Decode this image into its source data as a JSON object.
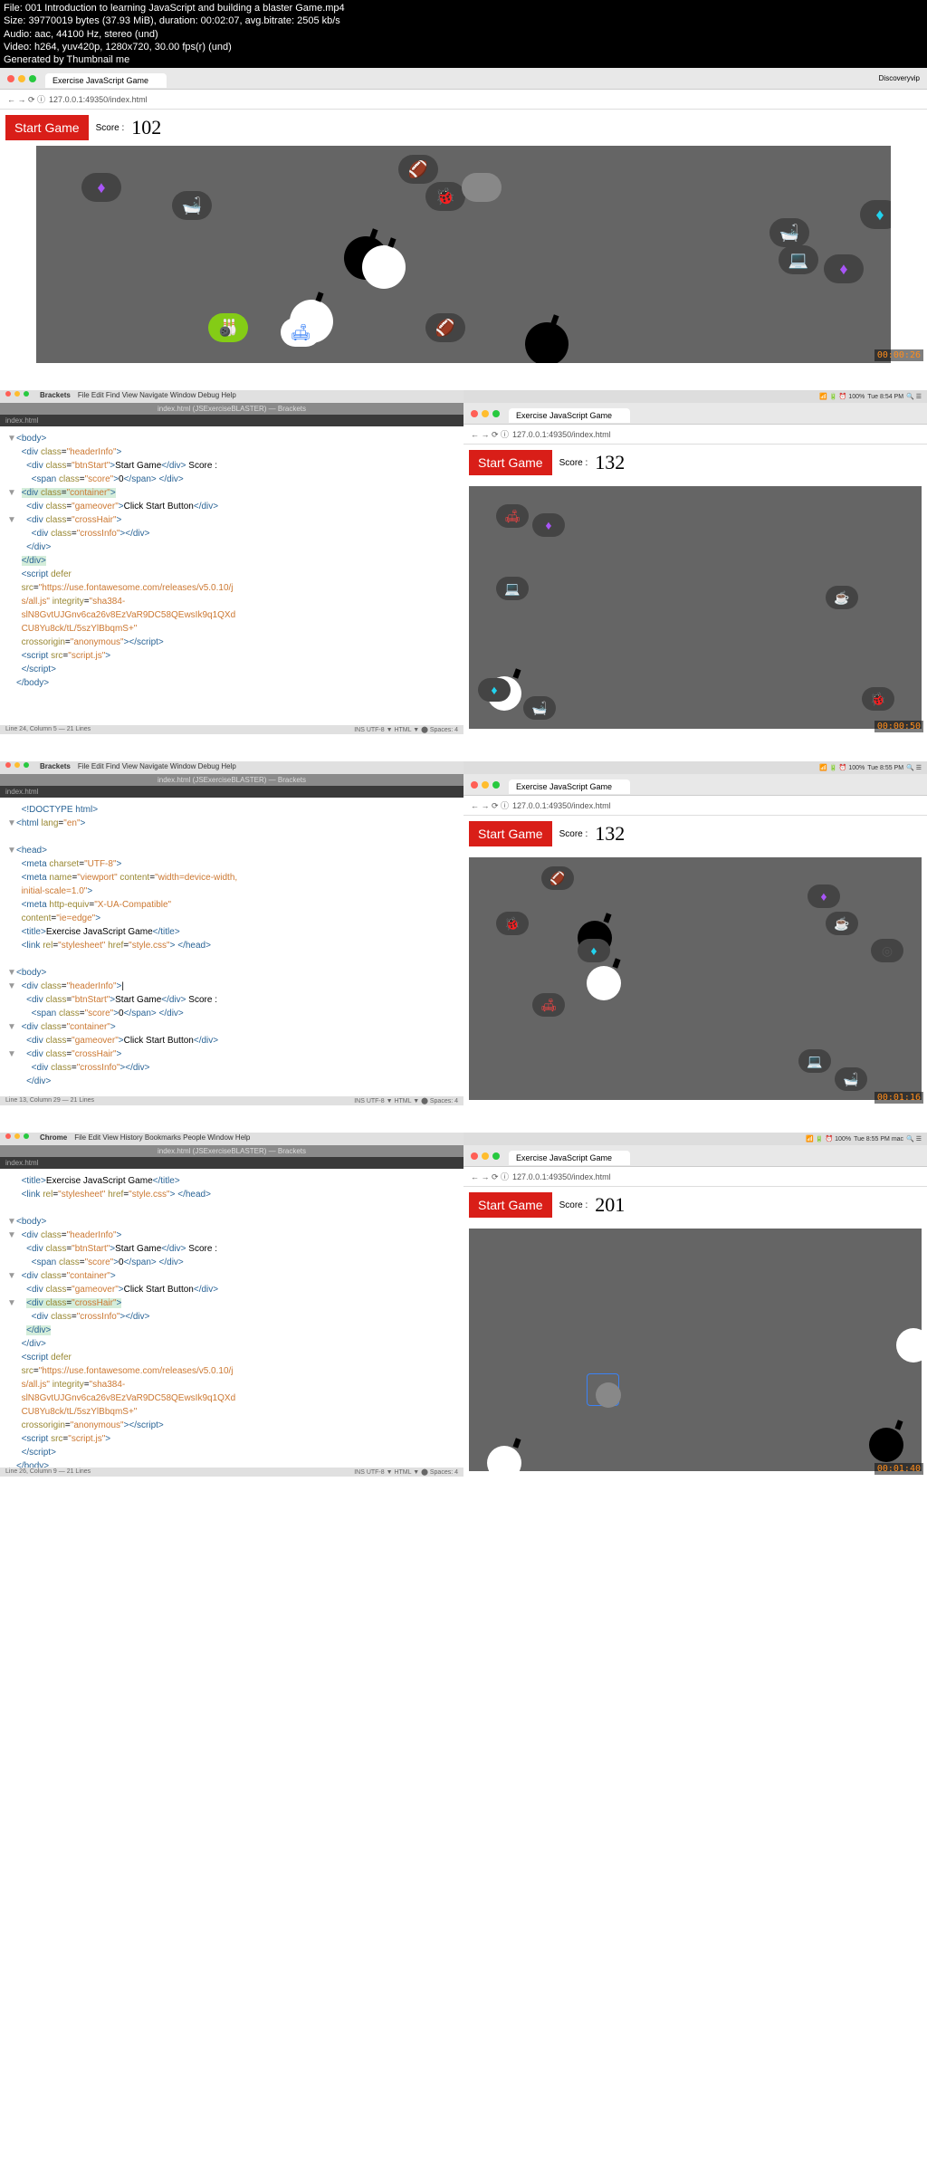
{
  "meta": {
    "l1": "File: 001 Introduction to learning JavaScript and building a blaster Game.mp4",
    "l2": "Size: 39770019 bytes (37.93 MiB), duration: 00:02:07, avg.bitrate: 2505 kb/s",
    "l3": "Audio: aac, 44100 Hz, stereo (und)",
    "l4": "Video: h264, yuv420p, 1280x720, 30.00 fps(r) (und)",
    "l5": "Generated by Thumbnail me"
  },
  "frame1": {
    "tab": "Exercise JavaScript Game",
    "url": "127.0.0.1:49350/index.html",
    "right_label": "Discoveryvip",
    "start": "Start Game",
    "score_lbl": "Score :",
    "score": "102",
    "ts": "00:00:26"
  },
  "frame2": {
    "app": "Brackets",
    "menu": "File  Edit  Find  View  Navigate  Window  Debug  Help",
    "title": "index.html (JSExerciseBLASTER) — Brackets",
    "tabfile": "index.html",
    "time": "Tue 8:54 PM",
    "tab": "Exercise JavaScript Game",
    "url": "127.0.0.1:49350/index.html",
    "start": "Start Game",
    "score_lbl": "Score :",
    "score": "132",
    "ts": "00:00:50",
    "status": "Line 24, Column 5 — 21 Lines",
    "code": [
      {
        "fold": "▼",
        "html": "<span class='t'>&lt;body&gt;</span>"
      },
      {
        "html": "&nbsp;&nbsp;<span class='t'>&lt;div</span> <span class='a'>class</span>=<span class='s'>\"headerInfo\"</span><span class='t'>&gt;</span>"
      },
      {
        "html": "&nbsp;&nbsp;&nbsp;&nbsp;<span class='t'>&lt;div</span> <span class='a'>class</span>=<span class='s'>\"btnStart\"</span><span class='t'>&gt;</span>Start Game<span class='t'>&lt;/div&gt;</span> Score :"
      },
      {
        "html": "&nbsp;&nbsp;&nbsp;&nbsp;&nbsp;&nbsp;<span class='t'>&lt;span</span> <span class='a'>class</span>=<span class='s'>\"score\"</span><span class='t'>&gt;</span>0<span class='t'>&lt;/span&gt; &lt;/div&gt;</span>"
      },
      {
        "fold": "▼",
        "html": "&nbsp;&nbsp;<span class='hl'><span class='t'>&lt;div</span> <span class='a'>class</span>=<span class='s'>\"container\"</span><span class='t'>&gt;</span></span>"
      },
      {
        "html": "&nbsp;&nbsp;&nbsp;&nbsp;<span class='t'>&lt;div</span> <span class='a'>class</span>=<span class='s'>\"gameover\"</span><span class='t'>&gt;</span>Click Start Button<span class='t'>&lt;/div&gt;</span>"
      },
      {
        "fold": "▼",
        "html": "&nbsp;&nbsp;&nbsp;&nbsp;<span class='t'>&lt;div</span> <span class='a'>class</span>=<span class='s'>\"crossHair\"</span><span class='t'>&gt;</span>"
      },
      {
        "html": "&nbsp;&nbsp;&nbsp;&nbsp;&nbsp;&nbsp;<span class='t'>&lt;div</span> <span class='a'>class</span>=<span class='s'>\"crossInfo\"</span><span class='t'>&gt;&lt;/div&gt;</span>"
      },
      {
        "html": "&nbsp;&nbsp;&nbsp;&nbsp;<span class='t'>&lt;/div&gt;</span>"
      },
      {
        "html": "&nbsp;&nbsp;<span class='hl'><span class='t'>&lt;/div&gt;</span></span>"
      },
      {
        "html": "&nbsp;&nbsp;<span class='t'>&lt;script</span> <span class='a'>defer</span>"
      },
      {
        "html": "&nbsp;&nbsp;<span class='a'>src</span>=<span class='s'>\"https://use.fontawesome.com/releases/v5.0.10/j</span>"
      },
      {
        "html": "&nbsp;&nbsp;<span class='s'>s/all.js\"</span> <span class='a'>integrity</span>=<span class='s'>\"sha384-</span>"
      },
      {
        "html": "&nbsp;&nbsp;<span class='s'>slN8GvtUJGnv6ca26v8EzVaR9DC58QEwsIk9q1QXd</span>"
      },
      {
        "html": "&nbsp;&nbsp;<span class='s'>CU8Yu8ck/tL/5szYlBbqmS+\"</span>"
      },
      {
        "html": "&nbsp;&nbsp;<span class='a'>crossorigin</span>=<span class='s'>\"anonymous\"</span><span class='t'>&gt;&lt;/script&gt;</span>"
      },
      {
        "html": "&nbsp;&nbsp;<span class='t'>&lt;script</span> <span class='a'>src</span>=<span class='s'>\"script.js\"</span><span class='t'>&gt;</span>"
      },
      {
        "html": "&nbsp;&nbsp;<span class='t'>&lt;/script&gt;</span>"
      },
      {
        "html": "<span class='t'>&lt;/body&gt;</span>"
      }
    ]
  },
  "frame3": {
    "app": "Brackets",
    "menu": "File  Edit  Find  View  Navigate  Window  Debug  Help",
    "title": "index.html (JSExerciseBLASTER) — Brackets",
    "tabfile": "index.html",
    "time": "Tue 8:55 PM",
    "tab": "Exercise JavaScript Game",
    "url": "127.0.0.1:49350/index.html",
    "start": "Start Game",
    "score_lbl": "Score :",
    "score": "132",
    "ts": "00:01:16",
    "status": "Line 13, Column 29 — 21 Lines",
    "code": [
      {
        "html": "&nbsp;&nbsp;<span class='t'>&lt;!DOCTYPE html&gt;</span>"
      },
      {
        "fold": "▼",
        "html": "<span class='t'>&lt;html</span> <span class='a'>lang</span>=<span class='s'>\"en\"</span><span class='t'>&gt;</span>"
      },
      {
        "html": "&nbsp;"
      },
      {
        "fold": "▼",
        "html": "<span class='t'>&lt;head&gt;</span>"
      },
      {
        "html": "&nbsp;&nbsp;<span class='t'>&lt;meta</span> <span class='a'>charset</span>=<span class='s'>\"UTF-8\"</span><span class='t'>&gt;</span>"
      },
      {
        "html": "&nbsp;&nbsp;<span class='t'>&lt;meta</span> <span class='a'>name</span>=<span class='s'>\"viewport\"</span> <span class='a'>content</span>=<span class='s'>\"width=device-width,</span>"
      },
      {
        "html": "&nbsp;&nbsp;<span class='s'>initial-scale=1.0\"</span><span class='t'>&gt;</span>"
      },
      {
        "html": "&nbsp;&nbsp;<span class='t'>&lt;meta</span> <span class='a'>http-equiv</span>=<span class='s'>\"X-UA-Compatible\"</span>"
      },
      {
        "html": "&nbsp;&nbsp;<span class='a'>content</span>=<span class='s'>\"ie=edge\"</span><span class='t'>&gt;</span>"
      },
      {
        "html": "&nbsp;&nbsp;<span class='t'>&lt;title&gt;</span>Exercise JavaScript Game<span class='t'>&lt;/title&gt;</span>"
      },
      {
        "html": "&nbsp;&nbsp;<span class='t'>&lt;link</span> <span class='a'>rel</span>=<span class='s'>\"stylesheet\"</span> <span class='a'>href</span>=<span class='s'>\"style.css\"</span><span class='t'>&gt; &lt;/head&gt;</span>"
      },
      {
        "html": "&nbsp;"
      },
      {
        "fold": "▼",
        "html": "<span class='t'>&lt;body&gt;</span>"
      },
      {
        "fold": "▼",
        "html": "&nbsp;&nbsp;<span class='t'>&lt;div</span> <span class='a'>class</span>=<span class='s'>\"headerInfo\"</span><span class='t'>&gt;</span>|"
      },
      {
        "html": "&nbsp;&nbsp;&nbsp;&nbsp;<span class='t'>&lt;div</span> <span class='a'>class</span>=<span class='s'>\"btnStart\"</span><span class='t'>&gt;</span>Start Game<span class='t'>&lt;/div&gt;</span> Score :"
      },
      {
        "html": "&nbsp;&nbsp;&nbsp;&nbsp;&nbsp;&nbsp;<span class='t'>&lt;span</span> <span class='a'>class</span>=<span class='s'>\"score\"</span><span class='t'>&gt;</span>0<span class='t'>&lt;/span&gt; &lt;/div&gt;</span>"
      },
      {
        "fold": "▼",
        "html": "&nbsp;&nbsp;<span class='t'>&lt;div</span> <span class='a'>class</span>=<span class='s'>\"container\"</span><span class='t'>&gt;</span>"
      },
      {
        "html": "&nbsp;&nbsp;&nbsp;&nbsp;<span class='t'>&lt;div</span> <span class='a'>class</span>=<span class='s'>\"gameover\"</span><span class='t'>&gt;</span>Click Start Button<span class='t'>&lt;/div&gt;</span>"
      },
      {
        "fold": "▼",
        "html": "&nbsp;&nbsp;&nbsp;&nbsp;<span class='t'>&lt;div</span> <span class='a'>class</span>=<span class='s'>\"crossHair\"</span><span class='t'>&gt;</span>"
      },
      {
        "html": "&nbsp;&nbsp;&nbsp;&nbsp;&nbsp;&nbsp;<span class='t'>&lt;div</span> <span class='a'>class</span>=<span class='s'>\"crossInfo\"</span><span class='t'>&gt;&lt;/div&gt;</span>"
      },
      {
        "html": "&nbsp;&nbsp;&nbsp;&nbsp;<span class='t'>&lt;/div&gt;</span>"
      }
    ]
  },
  "frame4": {
    "app": "Chrome",
    "menu": "File  Edit  View  History  Bookmarks  People  Window  Help",
    "title": "index.html (JSExerciseBLASTER) — Brackets",
    "tabfile": "index.html",
    "time": "Tue 8:55 PM  mac",
    "tab": "Exercise JavaScript Game",
    "url": "127.0.0.1:49350/index.html",
    "start": "Start Game",
    "score_lbl": "Score :",
    "score": "201",
    "ts": "00:01:40",
    "status": "Line 26, Column 9 — 21 Lines",
    "code": [
      {
        "html": "&nbsp;&nbsp;<span class='t'>&lt;title&gt;</span>Exercise JavaScript Game<span class='t'>&lt;/title&gt;</span>"
      },
      {
        "html": "&nbsp;&nbsp;<span class='t'>&lt;link</span> <span class='a'>rel</span>=<span class='s'>\"stylesheet\"</span> <span class='a'>href</span>=<span class='s'>\"style.css\"</span><span class='t'>&gt; &lt;/head&gt;</span>"
      },
      {
        "html": "&nbsp;"
      },
      {
        "fold": "▼",
        "html": "<span class='t'>&lt;body&gt;</span>"
      },
      {
        "fold": "▼",
        "html": "&nbsp;&nbsp;<span class='t'>&lt;div</span> <span class='a'>class</span>=<span class='s'>\"headerInfo\"</span><span class='t'>&gt;</span>"
      },
      {
        "html": "&nbsp;&nbsp;&nbsp;&nbsp;<span class='t'>&lt;div</span> <span class='a'>class</span>=<span class='s'>\"btnStart\"</span><span class='t'>&gt;</span>Start Game<span class='t'>&lt;/div&gt;</span> Score :"
      },
      {
        "html": "&nbsp;&nbsp;&nbsp;&nbsp;&nbsp;&nbsp;<span class='t'>&lt;span</span> <span class='a'>class</span>=<span class='s'>\"score\"</span><span class='t'>&gt;</span>0<span class='t'>&lt;/span&gt; &lt;/div&gt;</span>"
      },
      {
        "fold": "▼",
        "html": "&nbsp;&nbsp;<span class='t'>&lt;div</span> <span class='a'>class</span>=<span class='s'>\"container\"</span><span class='t'>&gt;</span>"
      },
      {
        "html": "&nbsp;&nbsp;&nbsp;&nbsp;<span class='t'>&lt;div</span> <span class='a'>class</span>=<span class='s'>\"gameover\"</span><span class='t'>&gt;</span>Click Start Button<span class='t'>&lt;/div&gt;</span>"
      },
      {
        "fold": "▼",
        "html": "&nbsp;&nbsp;&nbsp;&nbsp;<span class='hl'><span class='t'>&lt;div</span> <span class='a'>class</span>=<span class='s'>\"crossHair\"</span><span class='t'>&gt;</span></span>"
      },
      {
        "html": "&nbsp;&nbsp;&nbsp;&nbsp;&nbsp;&nbsp;<span class='t'>&lt;div</span> <span class='a'>class</span>=<span class='s'>\"crossInfo\"</span><span class='t'>&gt;&lt;/div&gt;</span>"
      },
      {
        "html": "&nbsp;&nbsp;&nbsp;&nbsp;<span class='hl'><span class='t'>&lt;/div&gt;</span></span>"
      },
      {
        "html": "&nbsp;&nbsp;<span class='t'>&lt;/div&gt;</span>"
      },
      {
        "html": "&nbsp;&nbsp;<span class='t'>&lt;script</span> <span class='a'>defer</span>"
      },
      {
        "html": "&nbsp;&nbsp;<span class='a'>src</span>=<span class='s'>\"https://use.fontawesome.com/releases/v5.0.10/j</span>"
      },
      {
        "html": "&nbsp;&nbsp;<span class='s'>s/all.js\"</span> <span class='a'>integrity</span>=<span class='s'>\"sha384-</span>"
      },
      {
        "html": "&nbsp;&nbsp;<span class='s'>slN8GvtUJGnv6ca26v8EzVaR9DC58QEwsIk9q1QXd</span>"
      },
      {
        "html": "&nbsp;&nbsp;<span class='s'>CU8Yu8ck/tL/5szYlBbqmS+\"</span>"
      },
      {
        "html": "&nbsp;&nbsp;<span class='a'>crossorigin</span>=<span class='s'>\"anonymous\"</span><span class='t'>&gt;&lt;/script&gt;</span>"
      },
      {
        "html": "&nbsp;&nbsp;<span class='t'>&lt;script</span> <span class='a'>src</span>=<span class='s'>\"script.js\"</span><span class='t'>&gt;</span>"
      },
      {
        "html": "&nbsp;&nbsp;<span class='t'>&lt;/script&gt;</span>"
      },
      {
        "html": "<span class='t'>&lt;/body&gt;</span>"
      }
    ]
  },
  "status_right": "INS   UTF-8 ▼   HTML ▼   ⬤   Spaces: 4"
}
